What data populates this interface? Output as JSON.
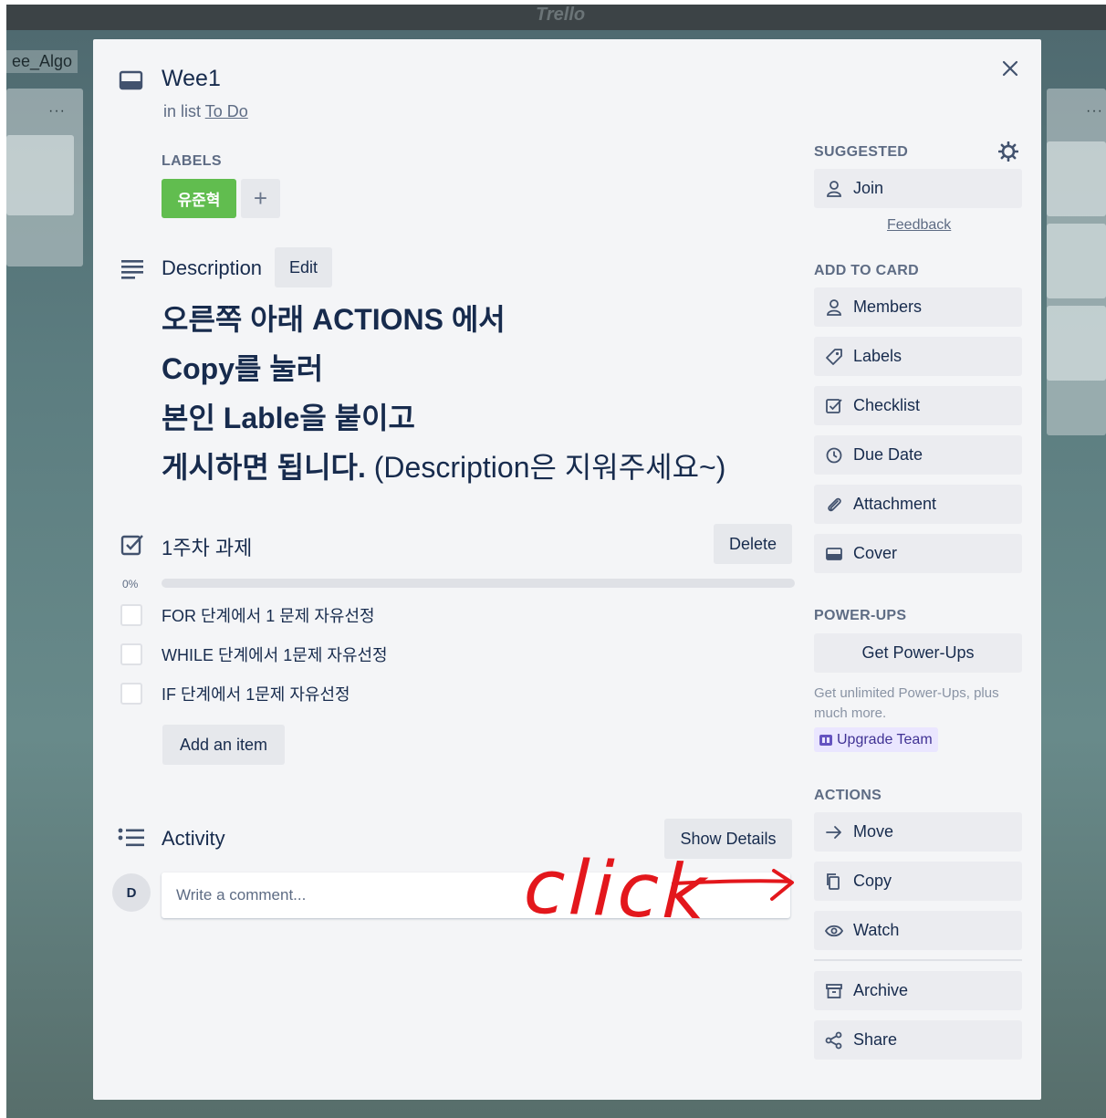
{
  "board": {
    "logo_text": "Trello",
    "name_fragment": "ee_Algo",
    "list_menu_icon": "ellipsis-icon"
  },
  "card": {
    "title": "Wee1",
    "in_list_prefix": "in list",
    "list_name": "To Do"
  },
  "labels": {
    "heading": "LABELS",
    "items": [
      {
        "text": "유준혁",
        "color": "#61bd4f"
      }
    ],
    "add_symbol": "+"
  },
  "description": {
    "title": "Description",
    "edit_label": "Edit",
    "lines": [
      "오른쪽 아래 ACTIONS 에서",
      "Copy를 눌러",
      "본인 Lable을 붙이고",
      {
        "bold": "게시하면 됩니다.",
        "normal": " (Description은 지워주세요~)"
      }
    ]
  },
  "checklist": {
    "title": "1주차 과제",
    "delete_label": "Delete",
    "progress_text": "0%",
    "progress": 0,
    "items": [
      {
        "text": "FOR 단계에서 1 문제 자유선정",
        "checked": false
      },
      {
        "text": "WHILE 단계에서 1문제 자유선정",
        "checked": false
      },
      {
        "text": "IF 단계에서 1문제 자유선정",
        "checked": false
      }
    ],
    "add_item_label": "Add an item"
  },
  "activity": {
    "title": "Activity",
    "show_details_label": "Show Details",
    "avatar_initial": "D",
    "comment_placeholder": "Write a comment..."
  },
  "sidebar": {
    "suggested": {
      "heading": "SUGGESTED",
      "join_label": "Join",
      "feedback_label": "Feedback"
    },
    "add_to_card": {
      "heading": "ADD TO CARD",
      "items": [
        {
          "label": "Members",
          "icon": "person-icon"
        },
        {
          "label": "Labels",
          "icon": "tag-icon"
        },
        {
          "label": "Checklist",
          "icon": "checklist-icon"
        },
        {
          "label": "Due Date",
          "icon": "clock-icon"
        },
        {
          "label": "Attachment",
          "icon": "paperclip-icon"
        },
        {
          "label": "Cover",
          "icon": "cover-icon"
        }
      ]
    },
    "power_ups": {
      "heading": "POWER-UPS",
      "get_label": "Get Power-Ups",
      "note": "Get unlimited Power-Ups, plus much more.",
      "upgrade_label": "Upgrade Team"
    },
    "actions": {
      "heading": "ACTIONS",
      "items": [
        {
          "label": "Move",
          "icon": "arrow-right-icon"
        },
        {
          "label": "Copy",
          "icon": "copy-icon"
        },
        {
          "label": "Watch",
          "icon": "eye-icon"
        },
        {
          "label": "Archive",
          "icon": "archive-icon"
        },
        {
          "label": "Share",
          "icon": "share-icon"
        }
      ]
    }
  },
  "annotation": {
    "text": "click",
    "color": "#e3171c"
  }
}
